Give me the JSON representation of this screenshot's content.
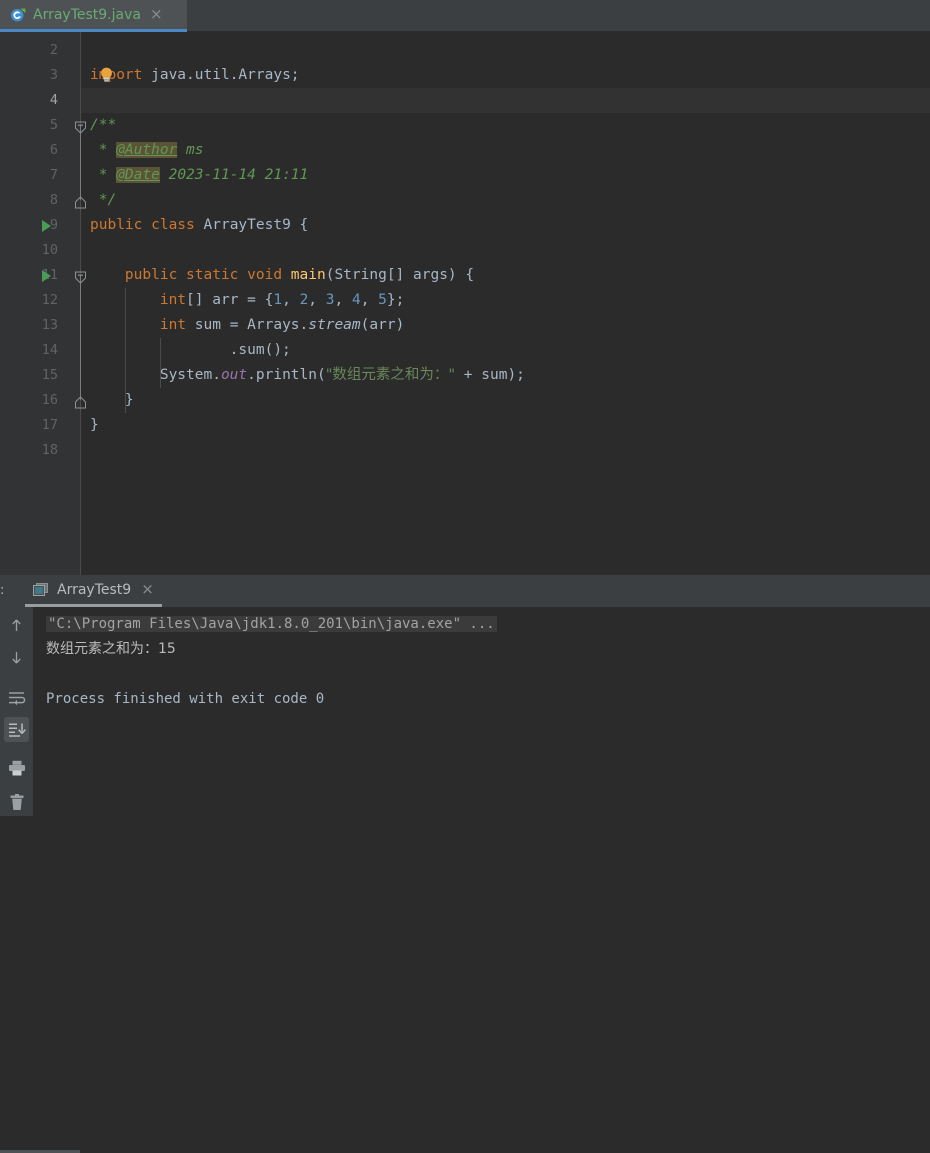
{
  "window": {
    "theme_accent": "#4a88c7",
    "editor_bg": "#2b2b2b",
    "panel_bg": "#3c3f41",
    "gutter_bg": "#313335"
  },
  "editor_tab": {
    "label": "ArrayTest9.java",
    "close_label": "×",
    "icon": "java-class-icon"
  },
  "code": {
    "lines": [
      {
        "num": "2",
        "segments": []
      },
      {
        "num": "3",
        "segments": [
          {
            "t": "import",
            "c": "kw"
          },
          {
            "t": " java.util.Arrays;",
            "c": "plain"
          }
        ]
      },
      {
        "num": "4",
        "segments": []
      },
      {
        "num": "5",
        "segments": [
          {
            "t": "/**",
            "c": "cmt"
          }
        ]
      },
      {
        "num": "6",
        "segments": [
          {
            "t": " * ",
            "c": "cmt"
          },
          {
            "t": "@Author",
            "c": "tagm"
          },
          {
            "t": " ms",
            "c": "cmt"
          }
        ]
      },
      {
        "num": "7",
        "segments": [
          {
            "t": " * ",
            "c": "cmt"
          },
          {
            "t": "@Date",
            "c": "tagm"
          },
          {
            "t": " 2023-11-14 21:11",
            "c": "cmt"
          }
        ]
      },
      {
        "num": "8",
        "segments": [
          {
            "t": " */",
            "c": "cmt"
          }
        ]
      },
      {
        "num": "9",
        "segments": [
          {
            "t": "public class ",
            "c": "kw"
          },
          {
            "t": "ArrayTest9 {",
            "c": "plain"
          }
        ]
      },
      {
        "num": "10",
        "segments": []
      },
      {
        "num": "11",
        "segments": [
          {
            "t": "    ",
            "c": "plain"
          },
          {
            "t": "public static void ",
            "c": "kw"
          },
          {
            "t": "main",
            "c": "mname"
          },
          {
            "t": "(String[] args) {",
            "c": "plain"
          }
        ]
      },
      {
        "num": "12",
        "segments": [
          {
            "t": "        ",
            "c": "plain"
          },
          {
            "t": "int",
            "c": "kw"
          },
          {
            "t": "[] arr = {",
            "c": "plain"
          },
          {
            "t": "1",
            "c": "num"
          },
          {
            "t": ", ",
            "c": "plain"
          },
          {
            "t": "2",
            "c": "num"
          },
          {
            "t": ", ",
            "c": "plain"
          },
          {
            "t": "3",
            "c": "num"
          },
          {
            "t": ", ",
            "c": "plain"
          },
          {
            "t": "4",
            "c": "num"
          },
          {
            "t": ", ",
            "c": "plain"
          },
          {
            "t": "5",
            "c": "num"
          },
          {
            "t": "};",
            "c": "plain"
          }
        ]
      },
      {
        "num": "13",
        "segments": [
          {
            "t": "        ",
            "c": "plain"
          },
          {
            "t": "int",
            "c": "kw"
          },
          {
            "t": " sum = Arrays.",
            "c": "plain"
          },
          {
            "t": "stream",
            "c": "stat"
          },
          {
            "t": "(arr)",
            "c": "plain"
          }
        ]
      },
      {
        "num": "14",
        "segments": [
          {
            "t": "                .sum();",
            "c": "plain"
          }
        ]
      },
      {
        "num": "15",
        "segments": [
          {
            "t": "        System.",
            "c": "plain"
          },
          {
            "t": "out",
            "c": "field"
          },
          {
            "t": ".println(",
            "c": "plain"
          },
          {
            "t": "\"数组元素之和为：\"",
            "c": "str"
          },
          {
            "t": " + sum);",
            "c": "plain"
          }
        ]
      },
      {
        "num": "16",
        "segments": [
          {
            "t": "    }",
            "c": "plain"
          }
        ]
      },
      {
        "num": "17",
        "segments": [
          {
            "t": "}",
            "c": "plain"
          }
        ]
      },
      {
        "num": "18",
        "segments": []
      }
    ],
    "current_line_num": "4",
    "run_marker_lines": [
      "9",
      "11"
    ],
    "intention_bulb_line": "3"
  },
  "console": {
    "left_edge_marker": ":",
    "tab_label": "ArrayTest9",
    "tab_close_label": "×",
    "tab_icon": "console-window-icon",
    "output": [
      {
        "text": "\"C:\\Program Files\\Java\\jdk1.8.0_201\\bin\\java.exe\" ...",
        "style": "con-cmd"
      },
      {
        "text": "数组元素之和为：15",
        "style": "con-out"
      },
      {
        "text": "",
        "style": "con-out"
      },
      {
        "text": "Process finished with exit code 0",
        "style": "con-done"
      }
    ],
    "toolbar": [
      {
        "name": "scroll-up-icon",
        "active": false
      },
      {
        "name": "scroll-down-icon",
        "active": false
      },
      {
        "name": "soft-wrap-icon",
        "active": false
      },
      {
        "name": "scroll-to-end-icon",
        "active": true
      },
      {
        "name": "print-icon",
        "active": false
      },
      {
        "name": "trash-icon",
        "active": false
      }
    ]
  }
}
